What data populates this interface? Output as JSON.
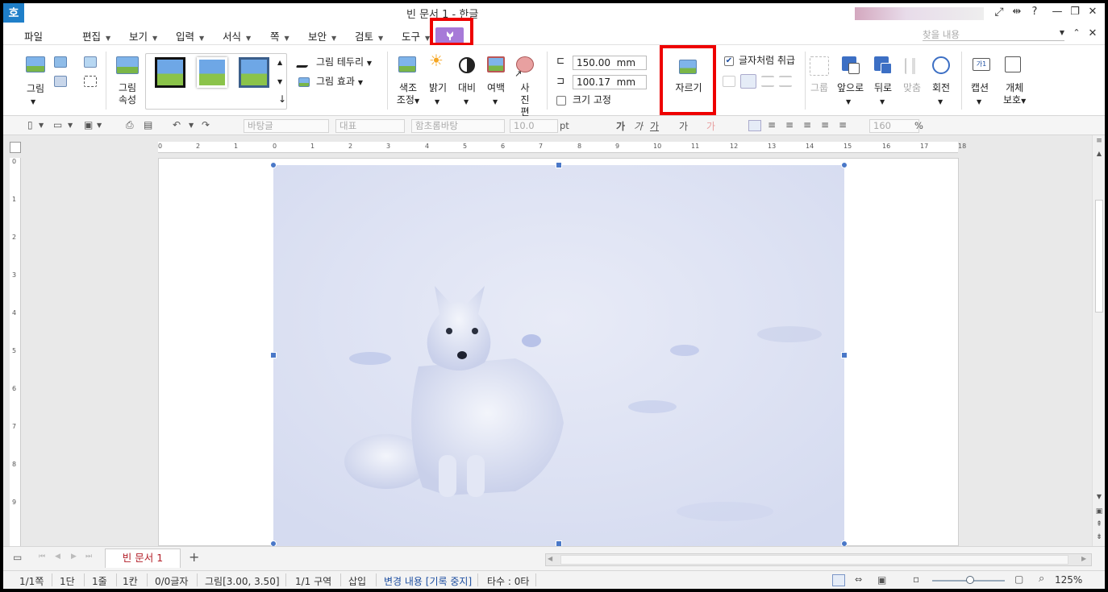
{
  "titlebar": {
    "app_icon": "호",
    "title": "빈 문서 1 - 한글",
    "controls": [
      "fullscreen-icon",
      "resize-icon",
      "help-icon",
      "minimize-icon",
      "restore-icon",
      "close-icon"
    ],
    "help": "?",
    "minimize": "—",
    "restore": "❐",
    "close": "✕"
  },
  "menubar": {
    "file": "파일",
    "items": [
      "편집",
      "보기",
      "입력",
      "서식",
      "쪽",
      "보안",
      "검토",
      "도구"
    ],
    "picture_tool_tab_icon": "picture-tool-icon",
    "find_placeholder": "찾을 내용"
  },
  "ribbon": {
    "picture": "그림",
    "picture_props": [
      "그림",
      "속성"
    ],
    "border": "그림 테두리",
    "effect": "그림 효과",
    "color_adjust": [
      "색조",
      "조정"
    ],
    "brightness": "밝기",
    "contrast": "대비",
    "margin": "여백",
    "photo_edit": [
      "사진",
      "편집"
    ],
    "width_value": "150.00",
    "height_value": "100.17",
    "unit": "mm",
    "lock_size": "크기 고정",
    "crop": "자르기",
    "treat_as_char": "글자처럼 취급",
    "group": "그룹",
    "front": "앞으로",
    "back": "뒤로",
    "align": "맞춤",
    "rotate": "회전",
    "caption": "캡션",
    "caption_icon_text": "가1",
    "protect": [
      "개체",
      "보호"
    ]
  },
  "toolbar": {
    "style": "바탕글",
    "lang": "대표",
    "font": "함초롬바탕",
    "size": "10.0",
    "size_unit": "pt",
    "zoom": "160",
    "zoom_unit": "%",
    "format_glyphs": [
      "가",
      "가",
      "가",
      "가",
      "가"
    ]
  },
  "ruler": {
    "h_ticks": [
      "0",
      "2",
      "1",
      "0",
      "1",
      "2",
      "3",
      "4",
      "5",
      "6",
      "7",
      "8",
      "9",
      "10",
      "11",
      "12",
      "13",
      "14",
      "15",
      "16",
      "17",
      "18"
    ],
    "v_ticks": [
      "0",
      "1",
      "2",
      "3",
      "4",
      "5",
      "6",
      "7",
      "8",
      "9"
    ]
  },
  "tabs": {
    "doc_tab": "빈 문서 1",
    "add": "+"
  },
  "status": {
    "page": "1/1쪽",
    "col": "1단",
    "line": "1줄",
    "cell": "1칸",
    "chars": "0/0글자",
    "object": "그림[3.00, 3.50]",
    "section": "1/1 구역",
    "mode": "삽입",
    "track": "변경 내용 [기록 중지]",
    "typing": "타수 : 0타",
    "zoom": "125%"
  }
}
